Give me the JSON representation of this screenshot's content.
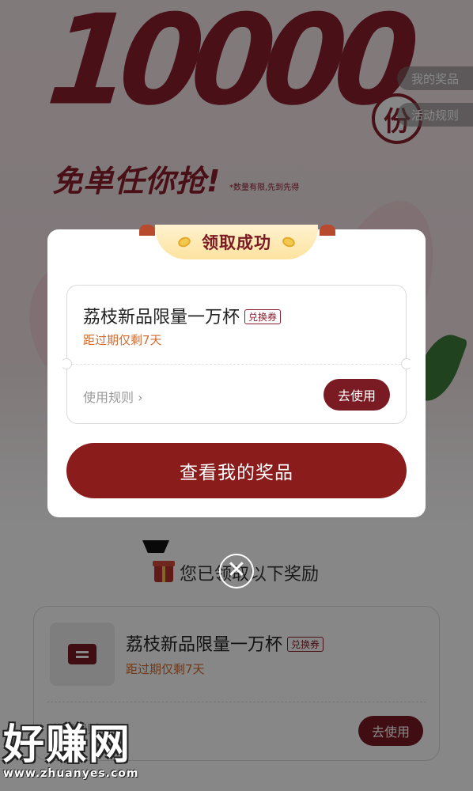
{
  "background": {
    "hero_number": "10000",
    "hero_unit": "份",
    "slogan": "免单任你抢!",
    "slogan_note": "*数量有限,先到先得",
    "side_tabs": [
      {
        "label": "我的奖品"
      },
      {
        "label": "活动规则"
      }
    ],
    "received_title": "您已领取以下奖励",
    "card": {
      "name": "荔枝新品限量一万杯",
      "tag": "兑换券",
      "expire": "距过期仅剩7天",
      "rules": "使用规则 ›",
      "use_label": "去使用"
    }
  },
  "modal": {
    "title": "领取成功",
    "coupon": {
      "name": "荔枝新品限量一万杯",
      "tag": "兑换券",
      "expire": "距过期仅剩7天",
      "rules": "使用规则 ›",
      "use_label": "去使用"
    },
    "primary_label": "查看我的奖品",
    "close_glyph": "✕"
  },
  "watermark": {
    "main": "好赚网",
    "sub": "www.zhuanyes.com"
  },
  "colors": {
    "brand": "#8b1c1c",
    "accent_orange": "#d26b2e",
    "ribbon": "#fde3a0"
  }
}
